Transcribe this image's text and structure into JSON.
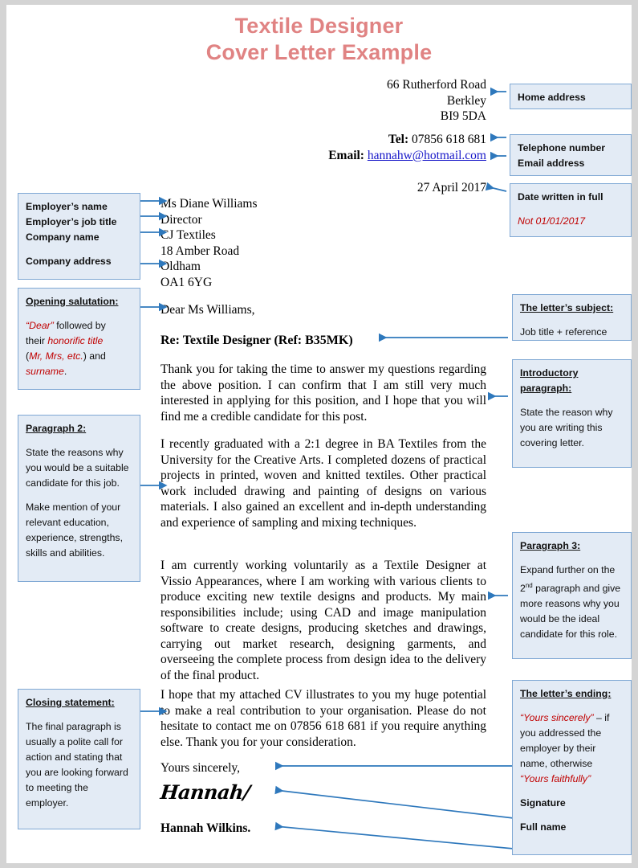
{
  "page": {
    "title_line1": "Textile Designer",
    "title_line2": "Cover Letter Example",
    "title_color": "#e08383",
    "callout_fill": "#e3ebf5",
    "callout_border": "#7fa8d4",
    "arrow_color": "#2e78bc",
    "red_accent": "#c00000"
  },
  "letter": {
    "sender_address": {
      "line1": "66 Rutherford Road",
      "line2": "Berkley",
      "line3": "BI9 5DA"
    },
    "contact": {
      "tel_label": "Tel:",
      "tel_value": "07856 618 681",
      "email_label": "Email:",
      "email_value": "hannahw@hotmail.com"
    },
    "date": "27 April 2017",
    "recipient": {
      "name": "Ms Diane Williams",
      "job_title": "Director",
      "company": "CJ Textiles",
      "address_line1": "18 Amber Road",
      "address_line2": "Oldham",
      "address_line3": "OA1 6YG"
    },
    "salutation": "Dear Ms Williams,",
    "subject": "Re: Textile Designer (Ref: B35MK)",
    "paragraph1": "Thank you for taking the time to answer my questions regarding the above position. I can confirm that I am still very much interested in applying for this position, and I hope that you will find me a credible candidate for this post.",
    "paragraph2": "I recently graduated with a 2:1 degree in BA Textiles from the University for the Creative Arts. I completed dozens of practical projects in printed, woven and knitted textiles. Other practical work included drawing and painting of designs on various materials. I also gained an excellent and in-depth understanding and experience of sampling and mixing techniques.",
    "paragraph3": "I am currently working voluntarily as a Textile Designer at Vissio Appearances, where I am working with various clients to produce exciting new textile designs and products. My main responsibilities include; using CAD and image manipulation software to create designs, producing sketches and drawings, carrying out market research, designing garments, and overseeing the complete process from design idea to the delivery of the final product.",
    "paragraph4": "I hope that my attached CV illustrates to you my huge potential to make a real contribution to your organisation. Please do not hesitate to contact me on 07856 618 681 if you require anything else. Thank you for your consideration.",
    "sign_off": "Yours sincerely,",
    "signature": "Hannah/",
    "full_name": "Hannah Wilkins."
  },
  "callouts": {
    "home_address": {
      "title": "Home address"
    },
    "telephone": {
      "line1": "Telephone number",
      "line2": "Email address"
    },
    "date_written": {
      "line1": "Date written in full",
      "line2": "Not 01/01/2017"
    },
    "employer": {
      "line1": "Employer’s name",
      "line2": "Employer’s job title",
      "line3": "Company name",
      "line4": "Company address"
    },
    "salutation": {
      "heading": "Opening salutation:",
      "t1": "“Dear”",
      "t2": " followed by",
      "t3": "their ",
      "t4": "honorific title",
      "t5": "(",
      "t6": "Mr, Mrs, etc.",
      "t7": ") and",
      "t8": "surname",
      "t9": "."
    },
    "subject": {
      "heading": "The letter’s subject:",
      "body": "Job title + reference"
    },
    "intro": {
      "heading1": "Introductory",
      "heading2": "paragraph:",
      "body": "State the reason why you are writing this covering letter."
    },
    "paragraph2": {
      "heading": "Paragraph 2:",
      "body1": "State the reasons why you would be a suitable candidate for this job.",
      "body2": "Make mention of your relevant education, experience, strengths, skills and abilities."
    },
    "paragraph3": {
      "heading": "Paragraph 3:",
      "body_a": "Expand further on the 2",
      "body_sup": "nd",
      "body_b": " paragraph and give more reasons why you would be the ideal candidate for this role."
    },
    "closing": {
      "heading": "Closing statement:",
      "body": "The final paragraph is usually a polite call for action and stating that you are looking forward to meeting the employer."
    },
    "ending": {
      "heading": "The letter’s ending:",
      "t1": "“Yours sincerely”",
      "t2": " – if",
      "t3": "you addressed the",
      "t4": "employer by their",
      "t5": "name, otherwise",
      "t6": "“Yours faithfully”",
      "t7": "Signature",
      "t8": "Full name"
    }
  }
}
